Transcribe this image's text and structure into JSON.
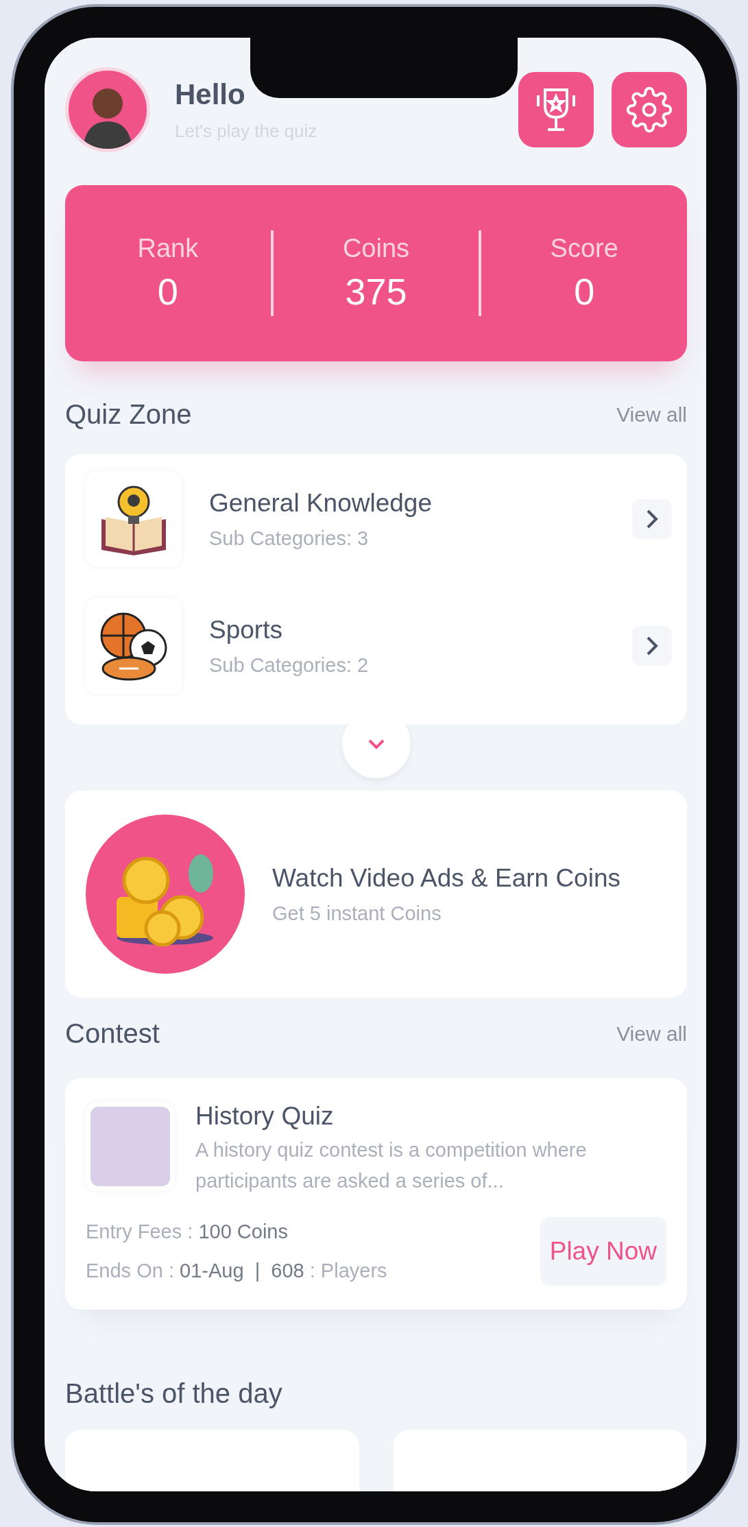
{
  "header": {
    "greeting": "Hello",
    "subtitle": "Let's play the quiz"
  },
  "stats": [
    {
      "label": "Rank",
      "value": "0"
    },
    {
      "label": "Coins",
      "value": "375"
    },
    {
      "label": "Score",
      "value": "0"
    }
  ],
  "quiz_zone": {
    "title": "Quiz Zone",
    "view_all": "View all",
    "categories": [
      {
        "kind": "book",
        "name": "General Knowledge",
        "subtitle": "Sub Categories: 3"
      },
      {
        "kind": "balls",
        "name": "Sports",
        "subtitle": "Sub Categories: 2"
      }
    ]
  },
  "ads": {
    "title": "Watch Video Ads & Earn Coins",
    "subtitle": "Get 5 instant Coins"
  },
  "contest": {
    "title": "Contest",
    "view_all": "View all",
    "items": [
      {
        "name": "History Quiz",
        "description": "A history quiz contest is a competition where participants are asked a series of...",
        "entry": "Entry Fees : **100 Coins**",
        "ends": "Ends On : **01-Aug  |  608** : Players",
        "button": "Play Now"
      }
    ]
  },
  "battles": {
    "title": "Battle's of the day"
  }
}
